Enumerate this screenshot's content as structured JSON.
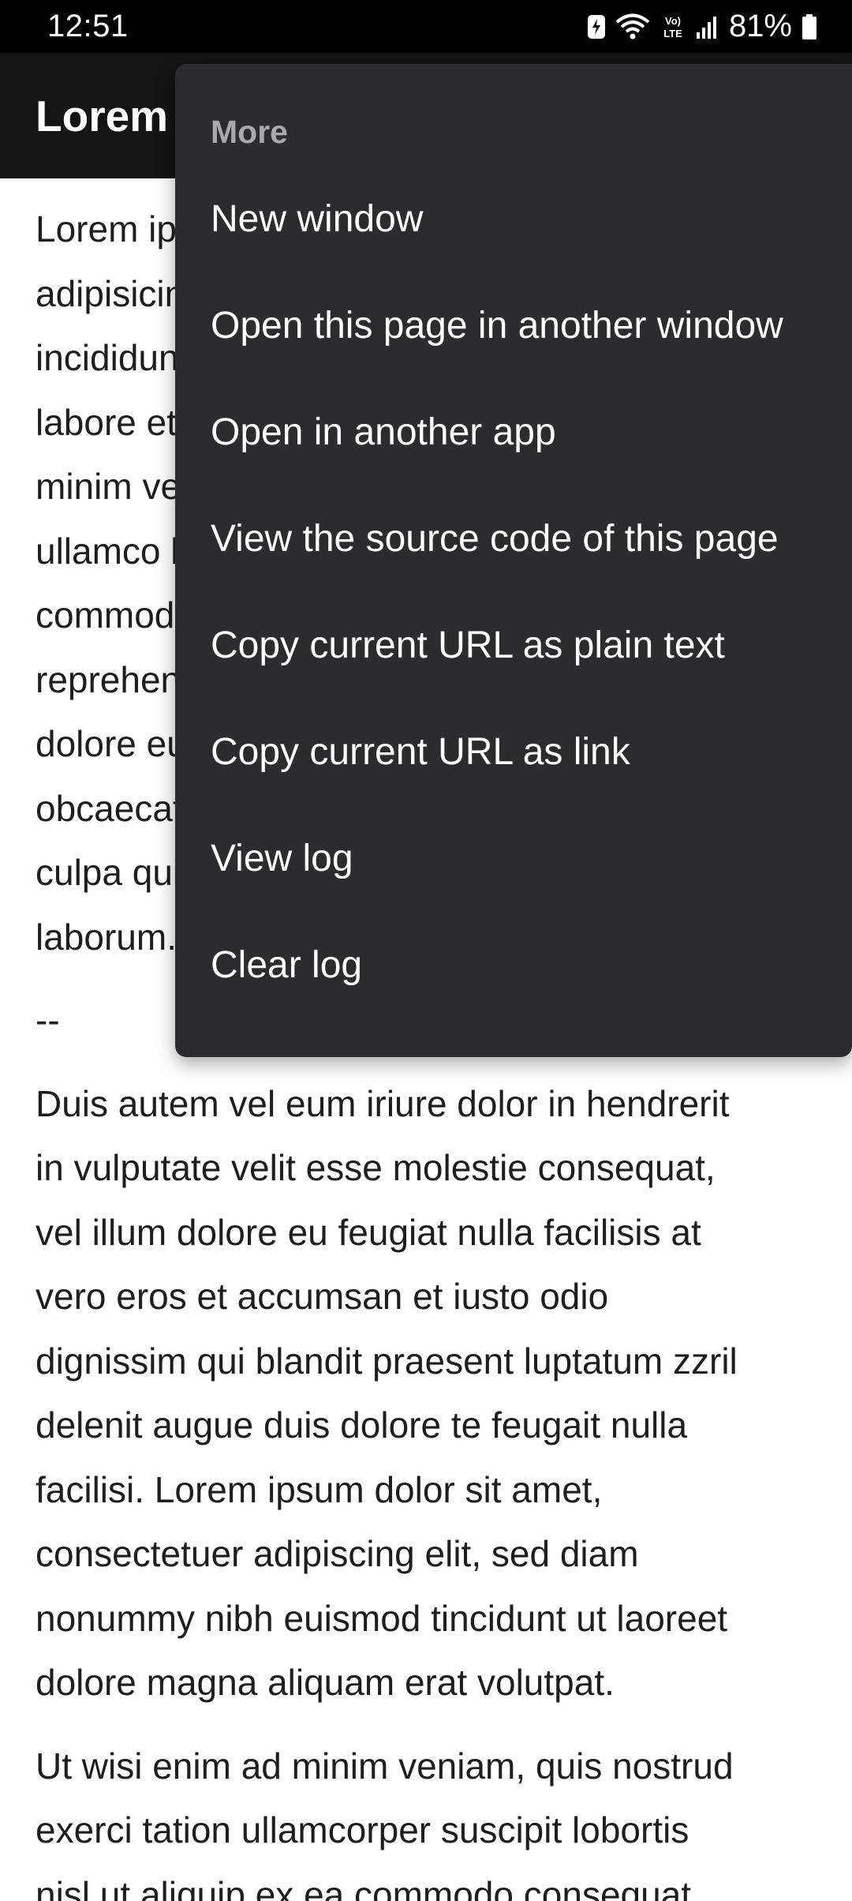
{
  "status_bar": {
    "time": "12:51",
    "battery_percent": "81%",
    "icons": [
      "data-saver-icon",
      "wifi-icon",
      "volte-icon",
      "signal-icon",
      "battery-icon"
    ]
  },
  "app_bar": {
    "title": "Lorem"
  },
  "content": {
    "paragraph_1": "Lorem ipsum dolor sit amet, consectetur\nadipisicing elit, sed do eiusmod tempor incididunt ut\nlabore et dolore magna aliqua. Ut enim ad\nminim veniam, quis nostrud exercitation\nullamco laboris nisi ut aliquip ex ea\ncommodo consequat. Duis aute irure dolor in\nreprehenderit in voluptate velit esse cillum\ndolore eu fugiat nulla pariatur. Excepteur sint\nobcaecat cupiditat non proident, sunt in\nculpa qui officia deserunt mollit anim id est\nlaborum.",
    "separator": "--",
    "paragraph_2": "Duis autem vel eum iriure dolor in hendrerit\nin vulputate velit esse molestie consequat,\nvel illum dolore eu feugiat nulla facilisis at\nvero eros et accumsan et iusto odio\ndignissim qui blandit praesent luptatum zzril\ndelenit augue duis dolore te feugait nulla\nfacilisi. Lorem ipsum dolor sit amet,\nconsectetuer adipiscing elit, sed diam\nnonummy nibh euismod tincidunt ut laoreet\ndolore magna aliquam erat volutpat.",
    "paragraph_3": "Ut wisi enim ad minim veniam, quis nostrud\nexerci tation ullamcorper suscipit lobortis\nnisl ut aliquip ex ea commodo consequat."
  },
  "menu": {
    "header": "More",
    "items": [
      {
        "label": "New window"
      },
      {
        "label": "Open this page in another window"
      },
      {
        "label": "Open in another app"
      },
      {
        "label": "View the source code of this page"
      },
      {
        "label": "Copy current URL as plain text"
      },
      {
        "label": "Copy current URL as link"
      },
      {
        "label": "View log"
      },
      {
        "label": "Clear log"
      }
    ]
  },
  "colors": {
    "status_bar_bg": "#000000",
    "app_bar_bg": "#141414",
    "menu_bg": "#2c2c2e",
    "menu_header_text": "#a9a9ab",
    "menu_item_text": "#ffffff",
    "content_text": "#1e1e1e"
  }
}
